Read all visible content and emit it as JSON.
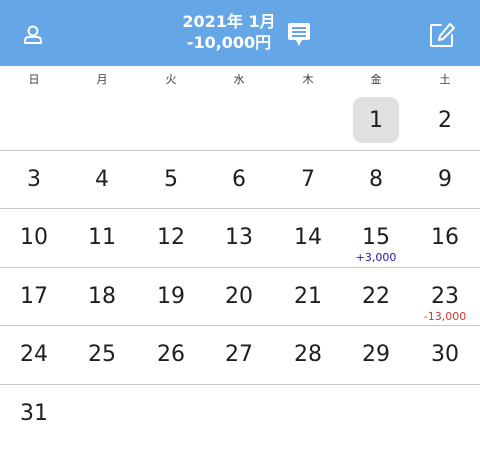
{
  "header": {
    "title": "2021年 1月",
    "total": "-10,000円",
    "background_color": "#64a6e6",
    "user_icon": "user-icon",
    "memo_icon": "memo-icon",
    "edit_icon": "edit-icon"
  },
  "weekdays": [
    "日",
    "月",
    "火",
    "水",
    "木",
    "金",
    "土"
  ],
  "calendar": {
    "today": "1",
    "income_color": "#1a1ab0",
    "expense_color": "#d23a2a",
    "weeks": [
      [
        {
          "day": "",
          "amount": "",
          "kind": ""
        },
        {
          "day": "",
          "amount": "",
          "kind": ""
        },
        {
          "day": "",
          "amount": "",
          "kind": ""
        },
        {
          "day": "",
          "amount": "",
          "kind": ""
        },
        {
          "day": "",
          "amount": "",
          "kind": ""
        },
        {
          "day": "1",
          "amount": "",
          "kind": ""
        },
        {
          "day": "2",
          "amount": "",
          "kind": ""
        }
      ],
      [
        {
          "day": "3",
          "amount": "",
          "kind": ""
        },
        {
          "day": "4",
          "amount": "",
          "kind": ""
        },
        {
          "day": "5",
          "amount": "",
          "kind": ""
        },
        {
          "day": "6",
          "amount": "",
          "kind": ""
        },
        {
          "day": "7",
          "amount": "",
          "kind": ""
        },
        {
          "day": "8",
          "amount": "",
          "kind": ""
        },
        {
          "day": "9",
          "amount": "",
          "kind": ""
        }
      ],
      [
        {
          "day": "10",
          "amount": "",
          "kind": ""
        },
        {
          "day": "11",
          "amount": "",
          "kind": ""
        },
        {
          "day": "12",
          "amount": "",
          "kind": ""
        },
        {
          "day": "13",
          "amount": "",
          "kind": ""
        },
        {
          "day": "14",
          "amount": "",
          "kind": ""
        },
        {
          "day": "15",
          "amount": "+3,000",
          "kind": "income"
        },
        {
          "day": "16",
          "amount": "",
          "kind": ""
        }
      ],
      [
        {
          "day": "17",
          "amount": "",
          "kind": ""
        },
        {
          "day": "18",
          "amount": "",
          "kind": ""
        },
        {
          "day": "19",
          "amount": "",
          "kind": ""
        },
        {
          "day": "20",
          "amount": "",
          "kind": ""
        },
        {
          "day": "21",
          "amount": "",
          "kind": ""
        },
        {
          "day": "22",
          "amount": "",
          "kind": ""
        },
        {
          "day": "23",
          "amount": "-13,000",
          "kind": "expense"
        }
      ],
      [
        {
          "day": "24",
          "amount": "",
          "kind": ""
        },
        {
          "day": "25",
          "amount": "",
          "kind": ""
        },
        {
          "day": "26",
          "amount": "",
          "kind": ""
        },
        {
          "day": "27",
          "amount": "",
          "kind": ""
        },
        {
          "day": "28",
          "amount": "",
          "kind": ""
        },
        {
          "day": "29",
          "amount": "",
          "kind": ""
        },
        {
          "day": "30",
          "amount": "",
          "kind": ""
        }
      ],
      [
        {
          "day": "31",
          "amount": "",
          "kind": ""
        },
        {
          "day": "",
          "amount": "",
          "kind": ""
        },
        {
          "day": "",
          "amount": "",
          "kind": ""
        },
        {
          "day": "",
          "amount": "",
          "kind": ""
        },
        {
          "day": "",
          "amount": "",
          "kind": ""
        },
        {
          "day": "",
          "amount": "",
          "kind": ""
        },
        {
          "day": "",
          "amount": "",
          "kind": ""
        }
      ]
    ]
  }
}
